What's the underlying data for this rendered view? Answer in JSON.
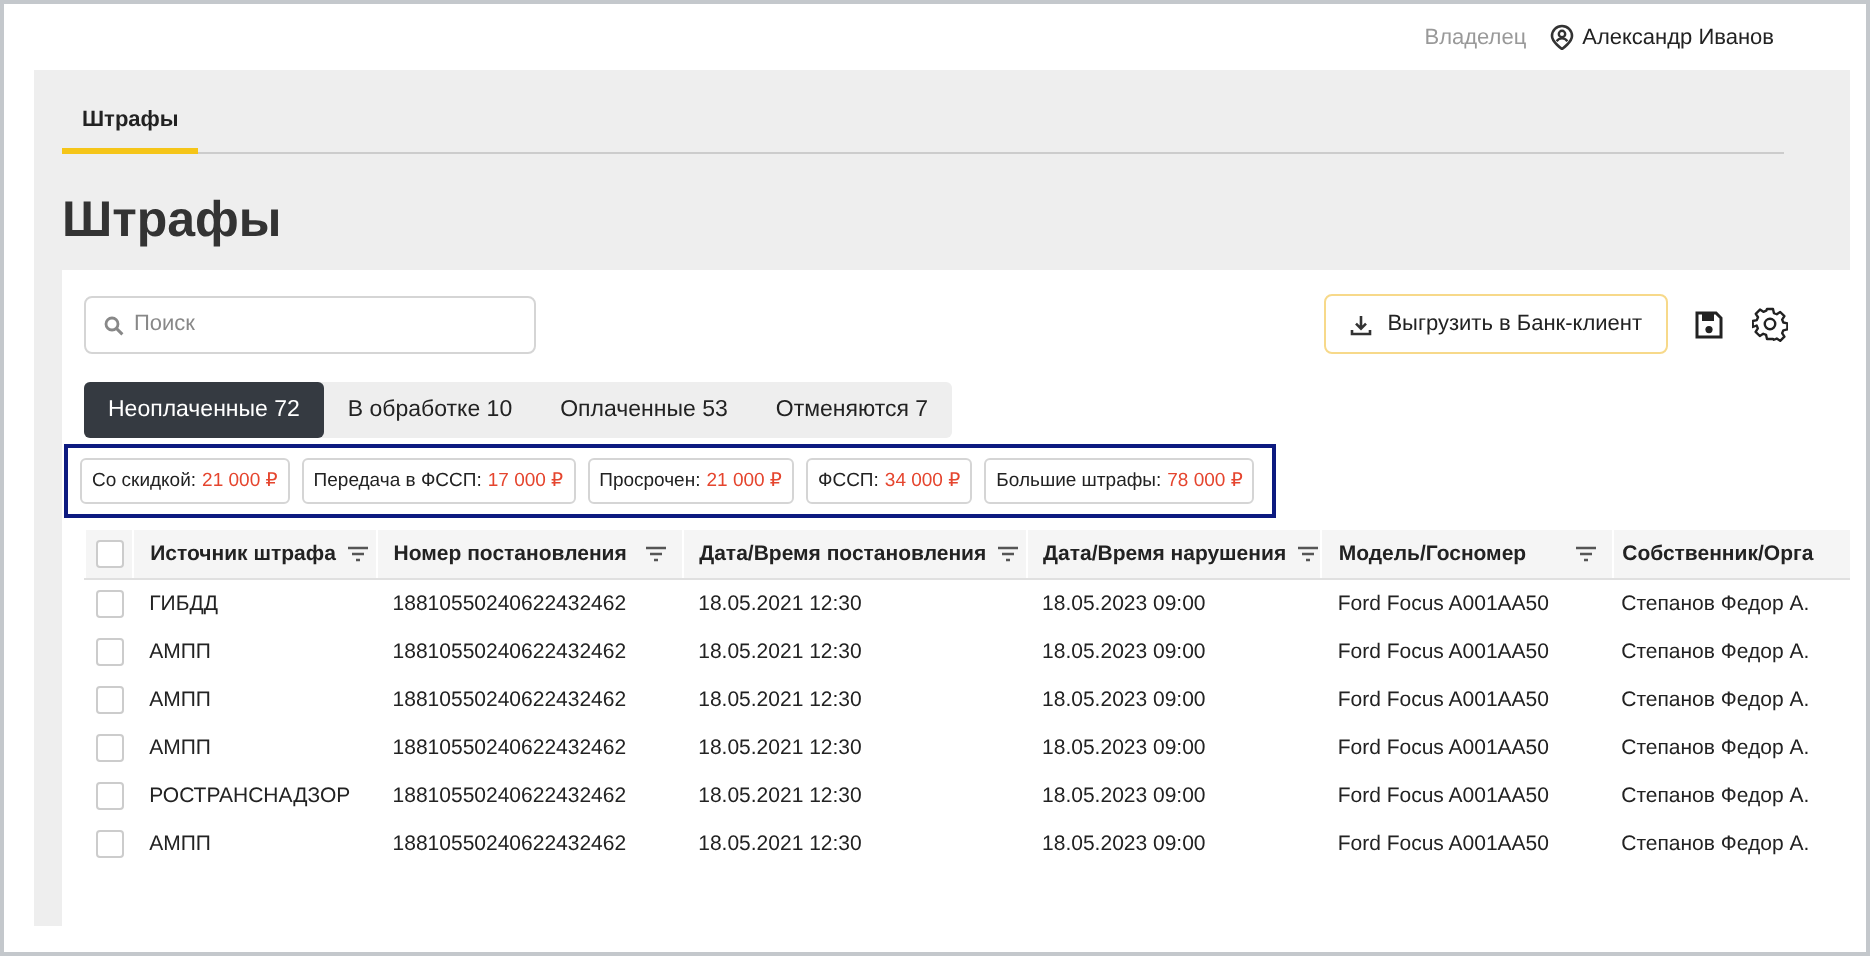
{
  "header": {
    "role": "Владелец",
    "user": "Александр Иванов"
  },
  "page_tabs": [
    {
      "label": "Штрафы",
      "selected": true
    }
  ],
  "title": "Штрафы",
  "search": {
    "placeholder": "Поиск"
  },
  "export_button": "Выгрузить в Банк-клиент",
  "status_tabs": [
    {
      "label": "Неоплаченные 72",
      "selected": true
    },
    {
      "label": "В обработке 10",
      "selected": false
    },
    {
      "label": "Оплаченные 53",
      "selected": false
    },
    {
      "label": "Отменяются 7",
      "selected": false
    }
  ],
  "summary_chips": [
    {
      "label": "Со скидкой:",
      "amount": "21 000 ₽"
    },
    {
      "label": "Передача в ФССП:",
      "amount": "17 000 ₽"
    },
    {
      "label": "Просрочен:",
      "amount": "21 000 ₽"
    },
    {
      "label": "ФССП:",
      "amount": "34 000 ₽"
    },
    {
      "label": "Большие штрафы:",
      "amount": "78 000 ₽"
    }
  ],
  "table": {
    "select_all_checked": false,
    "columns": [
      {
        "label": "Источник штрафа",
        "filter": true
      },
      {
        "label": "Номер постановления",
        "filter": true
      },
      {
        "label": "Дата/Время постановления",
        "filter": true
      },
      {
        "label": "Дата/Время нарушения",
        "filter": true
      },
      {
        "label": "Модель/Госномер",
        "filter": true
      },
      {
        "label": "Собственник/Орга",
        "filter": false
      }
    ],
    "rows": [
      {
        "checked": false,
        "cells": [
          "ГИБДД",
          "18810550240622432462",
          "18.05.2021 12:30",
          "18.05.2023 09:00",
          "Ford Focus A001AA50",
          "Степанов Федор А."
        ]
      },
      {
        "checked": false,
        "cells": [
          "АМПП",
          "18810550240622432462",
          "18.05.2021 12:30",
          "18.05.2023 09:00",
          "Ford Focus A001AA50",
          "Степанов Федор А."
        ]
      },
      {
        "checked": false,
        "cells": [
          "АМПП",
          "18810550240622432462",
          "18.05.2021 12:30",
          "18.05.2023 09:00",
          "Ford Focus A001AA50",
          "Степанов Федор А."
        ]
      },
      {
        "checked": false,
        "cells": [
          "АМПП",
          "18810550240622432462",
          "18.05.2021 12:30",
          "18.05.2023 09:00",
          "Ford Focus A001AA50",
          "Степанов Федор А."
        ]
      },
      {
        "checked": false,
        "cells": [
          "РОСТРАНСНАДЗОР",
          "18810550240622432462",
          "18.05.2021 12:30",
          "18.05.2023 09:00",
          "Ford Focus A001AA50",
          "Степанов Федор А."
        ]
      },
      {
        "checked": false,
        "cells": [
          "АМПП",
          "18810550240622432462",
          "18.05.2021 12:30",
          "18.05.2023 09:00",
          "Ford Focus A001AA50",
          "Степанов Федор А."
        ]
      }
    ]
  }
}
